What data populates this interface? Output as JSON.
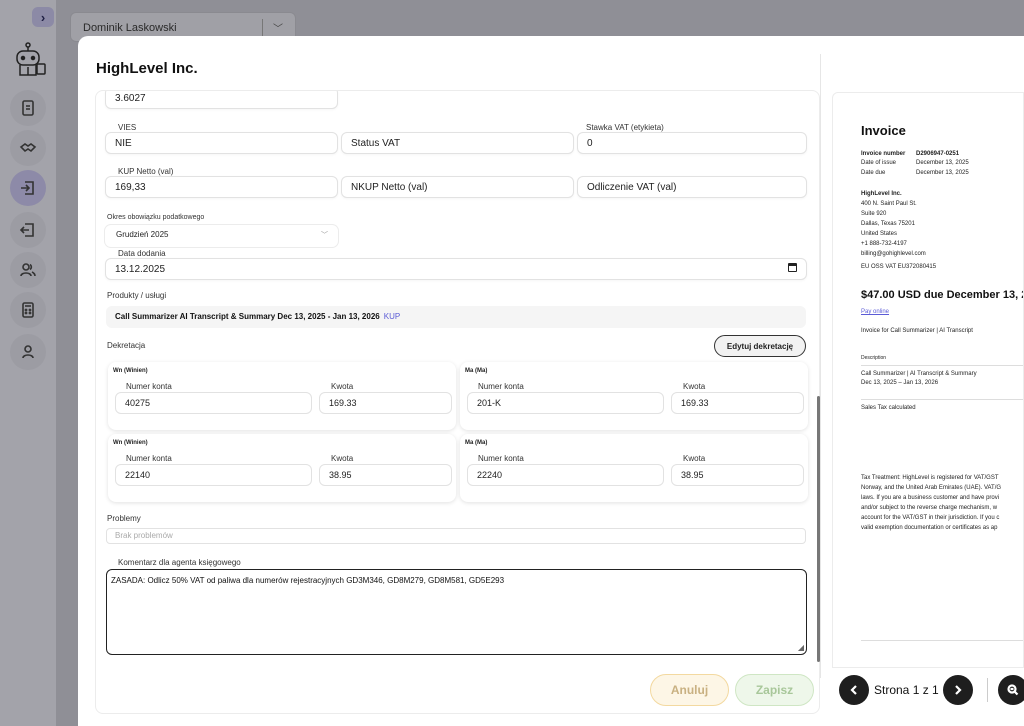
{
  "background": {
    "user_select_value": "Dominik Laskowski"
  },
  "modal": {
    "title": "HighLevel Inc."
  },
  "form": {
    "top_value": "3.6027",
    "vies_label": "VIES",
    "vies_value": "NIE",
    "status_vat_placeholder": "Status VAT",
    "stawka_label": "Stawka VAT (etykieta)",
    "stawka_value": "0",
    "kup_label": "KUP Netto (val)",
    "kup_value": "169,33",
    "nkup_placeholder": "NKUP Netto (val)",
    "odliczenie_placeholder": "Odliczenie VAT (val)",
    "okres_label": "Okres obowiązku podatkowego",
    "okres_value": "Grudzień 2025",
    "data_label": "Data dodania",
    "data_value": "13.12.2025",
    "produkty_label": "Produkty / usługi",
    "product_name": "Call Summarizer AI Transcript & Summary Dec 13, 2025 - Jan 13, 2026",
    "product_tag": "KUP",
    "dekretacja_label": "Dekretacja",
    "edit_button": "Edytuj dekretację",
    "problemy_label": "Problemy",
    "problemy_placeholder": "Brak problemów",
    "komentarz_label": "Komentarz dla agenta księgowego",
    "komentarz_value": "ZASADA: Odlicz 50% VAT od paliwa dla numerów rejestracyjnych GD3M346, GD8M279, GD8M581, GD5E293"
  },
  "dekretacja": [
    {
      "wn_label": "Wn (Winien)",
      "wn_konto_label": "Numer konta",
      "wn_konto": "40275",
      "wn_kwota_label": "Kwota",
      "wn_kwota": "169.33",
      "ma_label": "Ma (Ma)",
      "ma_konto_label": "Numer konta",
      "ma_konto": "201-K",
      "ma_kwota_label": "Kwota",
      "ma_kwota": "169.33"
    },
    {
      "wn_label": "Wn (Winien)",
      "wn_konto_label": "Numer konta",
      "wn_konto": "22140",
      "wn_kwota_label": "Kwota",
      "wn_kwota": "38.95",
      "ma_label": "Ma (Ma)",
      "ma_konto_label": "Numer konta",
      "ma_konto": "22240",
      "ma_kwota_label": "Kwota",
      "ma_kwota": "38.95"
    }
  ],
  "actions": {
    "cancel": "Anuluj",
    "save": "Zapisz"
  },
  "invoice": {
    "title": "Invoice",
    "number_label": "Invoice number",
    "number": "D2906947-0251",
    "issue_label": "Date of issue",
    "issue": "December 13, 2025",
    "due_label": "Date due",
    "due": "December 13, 2025",
    "company": "HighLevel Inc.",
    "address": [
      "400 N. Saint Paul St.",
      "Suite 920",
      "Dallas, Texas 75201",
      "United States",
      "+1 888-732-4197",
      "billing@gohighlevel.com"
    ],
    "vat": "EU OSS VAT  EU372080415",
    "amount_due": "$47.00 USD due December 13, 20",
    "pay_online": "Pay online",
    "invoice_for": "Invoice for Call Summarizer | AI Transcript",
    "desc_header": "Description",
    "desc_line1": "Call Summarizer | AI Transcript & Summary",
    "desc_line2": "Dec 13, 2025 – Jan 13, 2026",
    "sales_tax": "Sales Tax calculated",
    "tax_lines": [
      "Tax Treatment: HighLevel is registered for VAT/GST",
      "Norway, and the United Arab Emirates (UAE). VAT/G",
      "laws. If you are a business customer and have provi",
      "and/or subject to the reverse charge mechanism, w",
      "account for the VAT/GST in their jurisdiction. If you c",
      "valid exemption documentation or certificates as ap"
    ]
  },
  "pager": {
    "text": "Strona 1 z 1"
  }
}
